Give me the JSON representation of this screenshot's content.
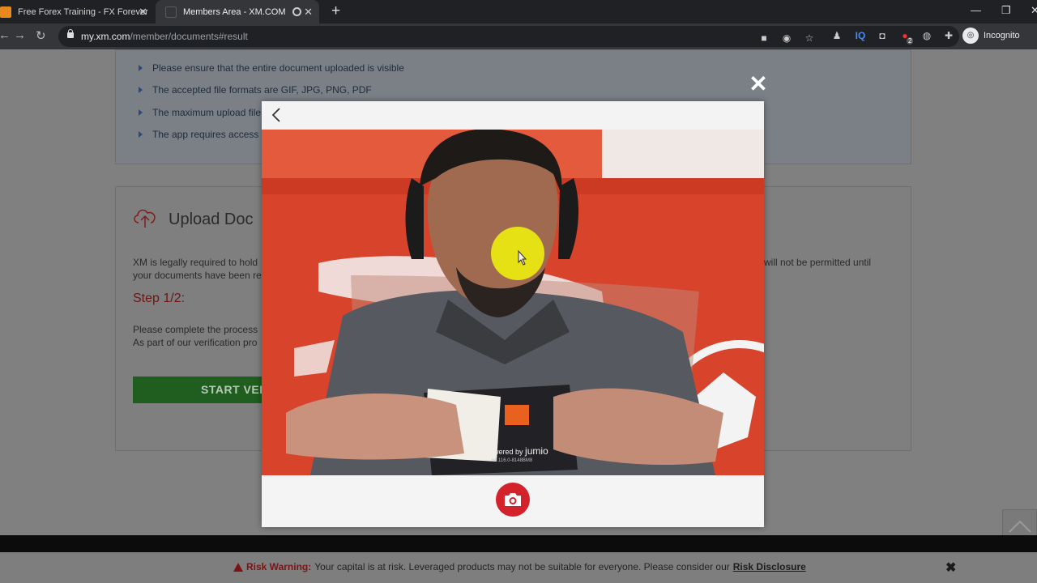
{
  "browser": {
    "tabs": [
      {
        "title": "Free Forex Training - FX Forever",
        "active": false
      },
      {
        "title": "Members Area - XM.COM",
        "active": true
      }
    ],
    "url_host": "my.xm.com",
    "url_path": "/member/documents#result",
    "profile_label": "Incognito",
    "extension_badge": "2",
    "extension_iq": "IQ"
  },
  "page": {
    "bullets": [
      "Please ensure that the entire document uploaded is visible",
      "The accepted file formats are GIF, JPG, PNG, PDF",
      "The maximum upload file",
      "The app requires access"
    ],
    "upload_title": "Upload Doc",
    "legal_left_line1": "XM is legally required to hold",
    "legal_left_line2": "your documents have been re",
    "legal_right": "will not be permitted until",
    "step": "Step 1/2:",
    "complete_line1": "Please complete the process",
    "complete_line2": "As part of our verification pro",
    "start_button": "START VERIF"
  },
  "modal": {
    "close_symbol": "✕",
    "powered_by": "Powered by",
    "brand": "jumio",
    "version": "v4.116.0-8148BM8"
  },
  "risk": {
    "label": "Risk Warning:",
    "text": "Your capital is at risk. Leveraged products may not be suitable for everyone. Please consider our",
    "link": "Risk Disclosure",
    "close": "✖"
  },
  "colors": {
    "accent_red": "#d4222c",
    "risk_red": "#7a1414",
    "start_green": "#1f5e1f"
  }
}
